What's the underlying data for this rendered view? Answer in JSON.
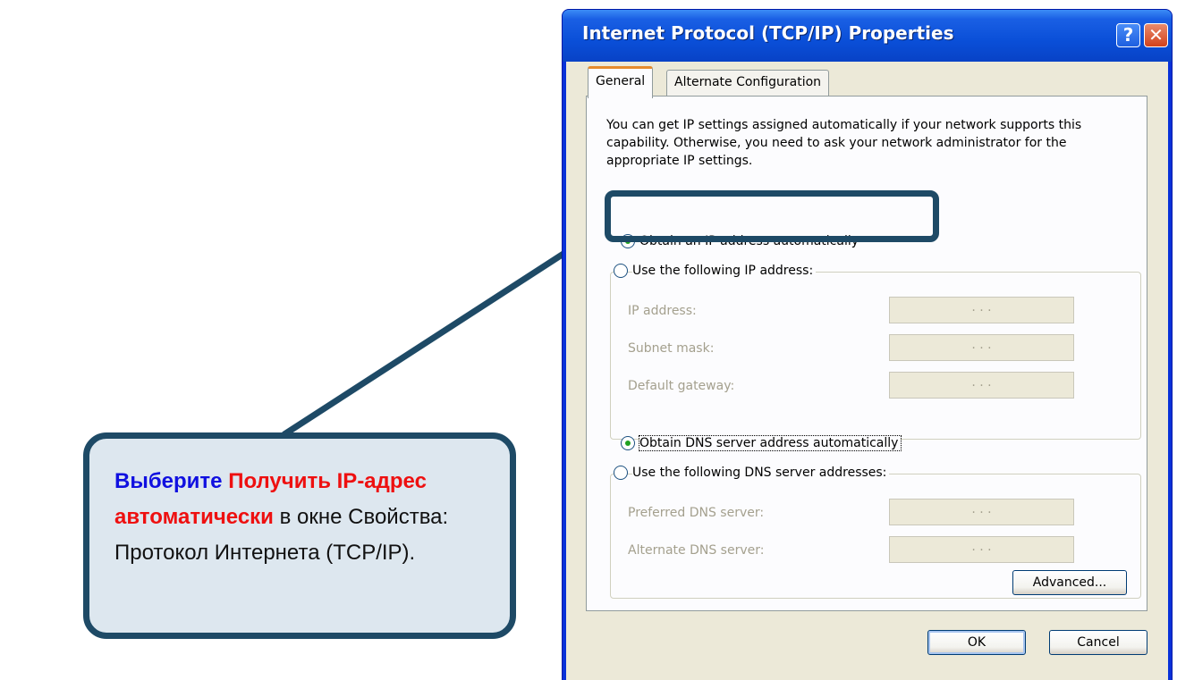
{
  "window": {
    "title": "Internet Protocol (TCP/IP) Properties",
    "help_glyph": "?",
    "close_glyph": "✕"
  },
  "tabs": [
    {
      "label": "General",
      "active": true
    },
    {
      "label": "Alternate Configuration",
      "active": false
    }
  ],
  "description": "You can get IP settings assigned automatically if your network supports this capability. Otherwise, you need to ask your network administrator for the appropriate IP settings.",
  "ip_mode": {
    "auto": {
      "label": "Obtain an IP address automatically",
      "checked": true
    },
    "manual": {
      "label": "Use the following IP address:",
      "checked": false,
      "fields": [
        {
          "label": "IP address:",
          "value": ". . ."
        },
        {
          "label": "Subnet mask:",
          "value": ". . ."
        },
        {
          "label": "Default gateway:",
          "value": ". . ."
        }
      ]
    }
  },
  "dns_mode": {
    "auto": {
      "label": "Obtain DNS server address automatically",
      "checked": true
    },
    "manual": {
      "label": "Use the following DNS server addresses:",
      "checked": false,
      "fields": [
        {
          "label": "Preferred DNS server:",
          "value": ". . ."
        },
        {
          "label": "Alternate DNS server:",
          "value": ". . ."
        }
      ]
    }
  },
  "buttons": {
    "advanced": "Advanced...",
    "ok": "OK",
    "cancel": "Cancel"
  },
  "callout": {
    "verb": "Выберите",
    "option": "Получить IP-адрес автоматически",
    "rest": "в окне Свойства: Протокол Интернета (TCP/IP)."
  },
  "colors": {
    "callout_border": "#1e4a66",
    "callout_fill": "#dde7ef",
    "callout_verb": "#1010e0",
    "callout_option": "#ee1010",
    "titlebar": "#0a4fd8"
  }
}
